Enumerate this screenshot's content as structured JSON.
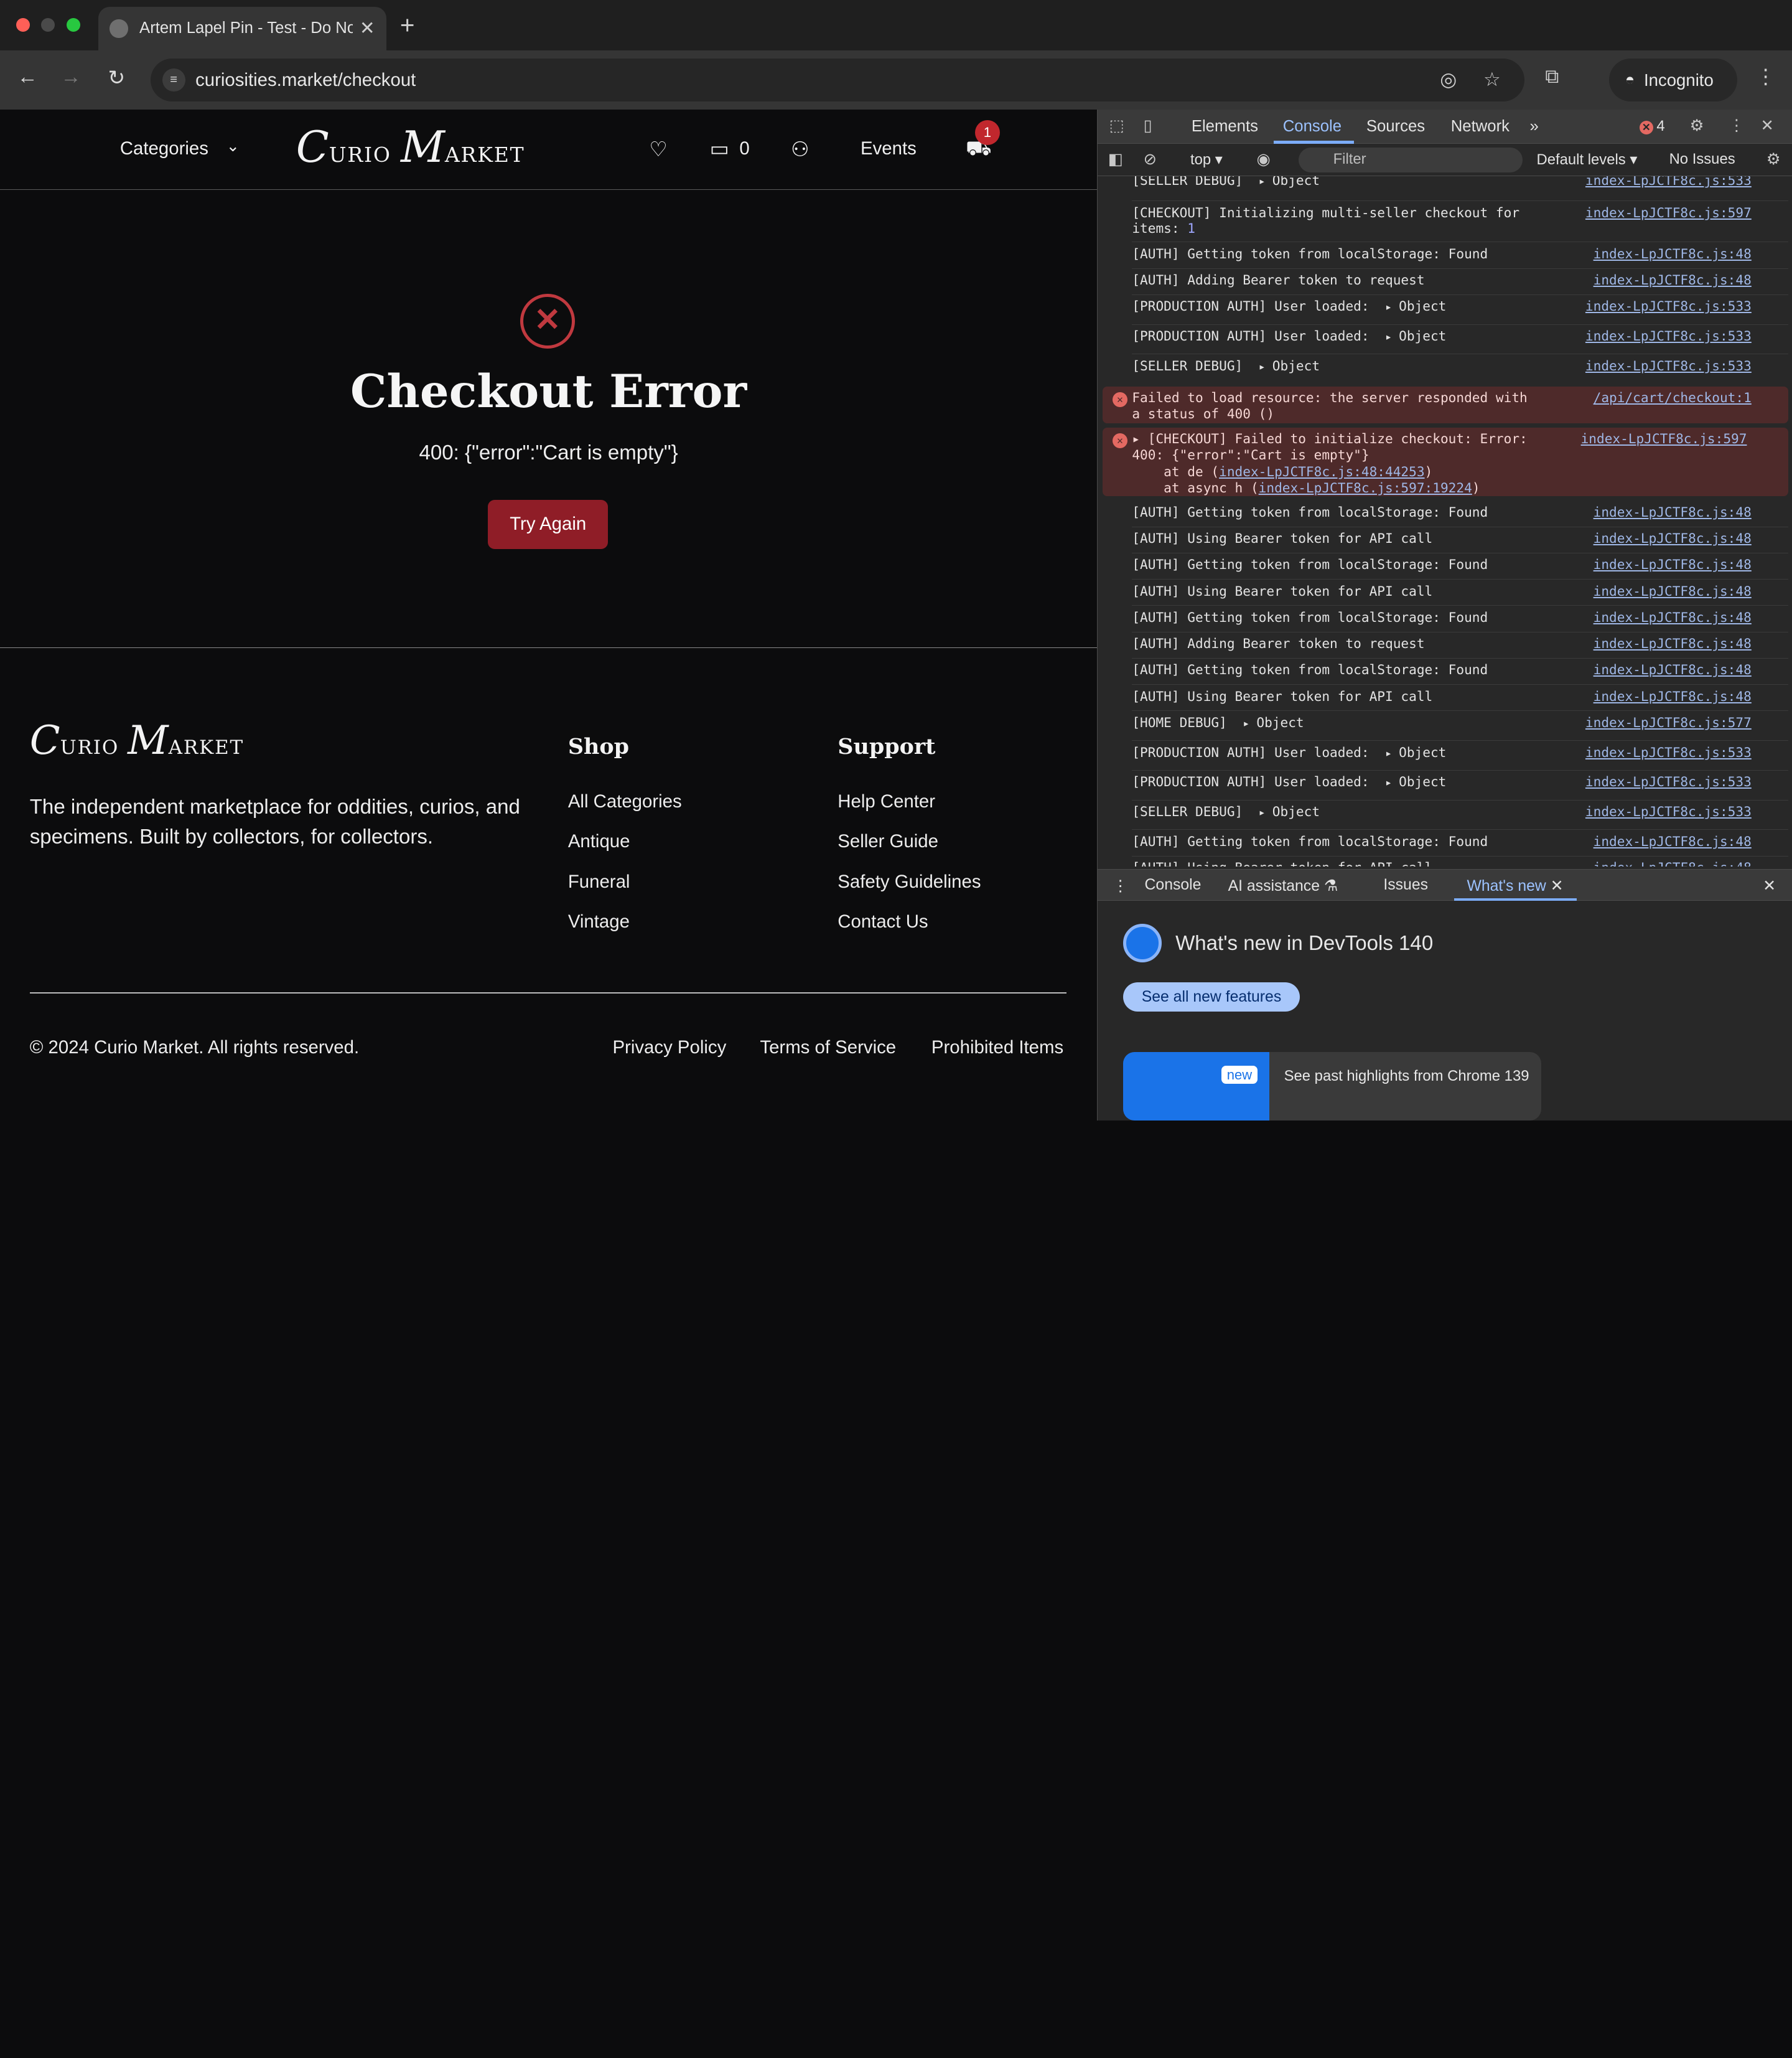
{
  "browser": {
    "tab_title": "Artem Lapel Pin - Test - Do Not Buy",
    "url": "curiosities.market/checkout",
    "incognito_label": "Incognito",
    "icons": {
      "back": "arrow-left-icon",
      "forward": "arrow-right-icon",
      "reload": "reload-icon",
      "site_info": "tune-icon",
      "eye_off": "eye-off-icon",
      "bookmark": "star-icon",
      "lens": "search-image-icon",
      "menu": "kebab-icon"
    }
  },
  "site": {
    "header": {
      "categories_label": "Categories",
      "logo_first": "C",
      "logo_first_rest": "urio",
      "logo_second": "M",
      "logo_second_rest": "arket",
      "message_count": "0",
      "events_label": "Events",
      "cart_badge": "1"
    },
    "error": {
      "title": "Checkout Error",
      "message": "400: {\"error\":\"Cart is empty\"}",
      "button_label": "Try Again",
      "color": "#c0393f"
    },
    "footer": {
      "tagline": "The independent marketplace for oddities, curios, and specimens. Built by collectors, for collectors.",
      "shop_heading": "Shop",
      "shop_links": [
        "All Categories",
        "Antique",
        "Funeral",
        "Vintage"
      ],
      "support_heading": "Support",
      "support_links": [
        "Help Center",
        "Seller Guide",
        "Safety Guidelines",
        "Contact Us"
      ],
      "copyright": "© 2024 Curio Market. All rights reserved.",
      "bottom_links": [
        "Privacy Policy",
        "Terms of Service",
        "Prohibited Items"
      ]
    }
  },
  "devtools": {
    "tabs": [
      "Elements",
      "Console",
      "Sources",
      "Network"
    ],
    "active_tab": "Console",
    "error_count": "4",
    "context": "top",
    "filter_placeholder": "Filter",
    "levels_label": "Default levels",
    "issues_label": "No Issues",
    "console_rows": [
      {
        "msg": "[SELLER DEBUG]",
        "obj": "Object",
        "src": "index-LpJCTF8c.js:533"
      },
      {
        "msg": "[CHECKOUT] Initializing multi-seller checkout for\nitems: ",
        "num": "1",
        "src": "index-LpJCTF8c.js:597"
      },
      {
        "msg": "[AUTH] Getting token from localStorage: Found",
        "src": "index-LpJCTF8c.js:48"
      },
      {
        "msg": "[AUTH] Adding Bearer token to request",
        "src": "index-LpJCTF8c.js:48"
      },
      {
        "msg": "[PRODUCTION AUTH] User loaded:",
        "obj": "Object",
        "src": "index-LpJCTF8c.js:533"
      },
      {
        "msg": "[PRODUCTION AUTH] User loaded:",
        "obj": "Object",
        "src": "index-LpJCTF8c.js:533"
      },
      {
        "msg": "[SELLER DEBUG]",
        "obj": "Object",
        "src": "index-LpJCTF8c.js:533"
      }
    ],
    "error_rows": [
      {
        "msg": "Failed to load resource: the server responded with\na status of 400 ()",
        "src": "/api/cart/checkout:1"
      },
      {
        "msg": "▸ [CHECKOUT] Failed to initialize checkout: Error:\n400: {\"error\":\"Cart is empty\"}\n    at de (",
        "link1": "index-LpJCTF8c.js:48:44253",
        "mid": ")\n    at async h (",
        "link2": "index-LpJCTF8c.js:597:19224",
        "tail": ")",
        "src": "index-LpJCTF8c.js:597"
      }
    ],
    "console_rows_after": [
      {
        "msg": "[AUTH] Getting token from localStorage: Found",
        "src": "index-LpJCTF8c.js:48"
      },
      {
        "msg": "[AUTH] Using Bearer token for API call",
        "src": "index-LpJCTF8c.js:48"
      },
      {
        "msg": "[AUTH] Getting token from localStorage: Found",
        "src": "index-LpJCTF8c.js:48"
      },
      {
        "msg": "[AUTH] Using Bearer token for API call",
        "src": "index-LpJCTF8c.js:48"
      },
      {
        "msg": "[AUTH] Getting token from localStorage: Found",
        "src": "index-LpJCTF8c.js:48"
      },
      {
        "msg": "[AUTH] Adding Bearer token to request",
        "src": "index-LpJCTF8c.js:48"
      },
      {
        "msg": "[AUTH] Getting token from localStorage: Found",
        "src": "index-LpJCTF8c.js:48"
      },
      {
        "msg": "[AUTH] Using Bearer token for API call",
        "src": "index-LpJCTF8c.js:48"
      },
      {
        "msg": "[HOME DEBUG]",
        "obj": "Object",
        "src": "index-LpJCTF8c.js:577"
      },
      {
        "msg": "[PRODUCTION AUTH] User loaded:",
        "obj": "Object",
        "src": "index-LpJCTF8c.js:533"
      },
      {
        "msg": "[PRODUCTION AUTH] User loaded:",
        "obj": "Object",
        "src": "index-LpJCTF8c.js:533"
      },
      {
        "msg": "[SELLER DEBUG]",
        "obj": "Object",
        "src": "index-LpJCTF8c.js:533"
      },
      {
        "msg": "[AUTH] Getting token from localStorage: Found",
        "src": "index-LpJCTF8c.js:48"
      },
      {
        "msg": "[AUTH] Using Bearer token for API call",
        "src": "index-LpJCTF8c.js:48"
      }
    ],
    "drawer_tabs": [
      "Console",
      "AI assistance",
      "Issues",
      "What's new"
    ],
    "whats_new_title": "What's new in DevTools 140",
    "whats_new_button": "See all new features",
    "highlight_badge": "new",
    "highlight_text": "See past highlights from Chrome 139"
  }
}
